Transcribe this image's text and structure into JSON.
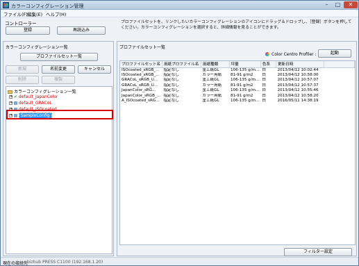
{
  "window": {
    "title": "カラーコンフィグレーション管理",
    "icon": "color-management-app-icon"
  },
  "menu": [
    "ファイル(F)",
    "編集(E)",
    "ヘルプ(H)"
  ],
  "controller": {
    "label": "コントローラー",
    "register_button": "登録",
    "reload_button": "再読込み"
  },
  "description": "プロファイルセットを、リンクしたいカラーコンフィグレーションのアイコンにドラッグ＆ドロップし、［登録］ボタンを押してください。カラーコンフィグレーションを選択すると、詳細情報を見ることができます。",
  "left_panel": {
    "title": "カラーコンフィグレーション一覧",
    "profile_set_list_button": "プロファイルセット一覧",
    "new_button": "新規",
    "rename_button": "名前変更",
    "cancel_button": "キャンセル",
    "delete_button": "削除",
    "copy_button": "複製",
    "tree_root": "カラーコンフィグレーション一覧",
    "tree_items": [
      {
        "label": "default_JapanColor",
        "color": "#d40000",
        "checked": true
      },
      {
        "label": "default_GRACoL",
        "color": "#d40000",
        "checked": false
      },
      {
        "label": "default_ISOcoated",
        "color": "#d40000",
        "checked": false
      },
      {
        "label": "SampleConfig",
        "color": "#ffffff",
        "checked": false,
        "selected": true
      }
    ]
  },
  "right_panel": {
    "title": "プロファイルセット一覧",
    "profiler_label": "Color Centro Profiler :",
    "launch_button": "起動",
    "filter_button": "フィルター設定",
    "columns": [
      "プロファイルセット名",
      "用紙プロファイル名",
      "用紙種類",
      "坪量",
      "色系",
      "更新日時"
    ],
    "rows": [
      [
        "ISOcoated_sRGB_...",
        "指定なし",
        "塗工紙GL",
        "106-135 g/m...",
        "白",
        "2013/04/12 10:02:44"
      ],
      [
        "ISOcoated_sRGB_...",
        "指定なし",
        "カラー用紙",
        "81-91 g/m2",
        "白",
        "2013/04/12 10:58:00"
      ],
      [
        "GRACoL_sRGB_U...",
        "指定なし",
        "塗工紙GL",
        "106-135 g/m...",
        "白",
        "2013/04/12 10:57:07"
      ],
      [
        "GRACoL_sRGB_U...",
        "指定なし",
        "カラー用紙",
        "81-91 g/m2",
        "白",
        "2013/04/12 10:57:37"
      ],
      [
        "JapanColor_sRG...",
        "指定なし",
        "塗工紙GL",
        "106-135 g/m...",
        "白",
        "2013/04/12 10:55:46"
      ],
      [
        "JapanColor_sRGB_...",
        "指定なし",
        "カラー用紙",
        "81-91 g/m2",
        "白",
        "2013/04/12 10:58:20"
      ],
      [
        "A_ISOcoated_sRG...",
        "指定なし",
        "塗工紙GL",
        "106-135 g/m...",
        "白",
        "2016/05/11 14:38:19"
      ]
    ]
  },
  "status": {
    "label": "現在の接続先",
    "value": "bizhub PRESS C1100 (192.168.1.20)"
  },
  "colors": {
    "highlight": "#3399ff",
    "red_frame": "#d50000",
    "tree_label_red": "#d40000"
  }
}
